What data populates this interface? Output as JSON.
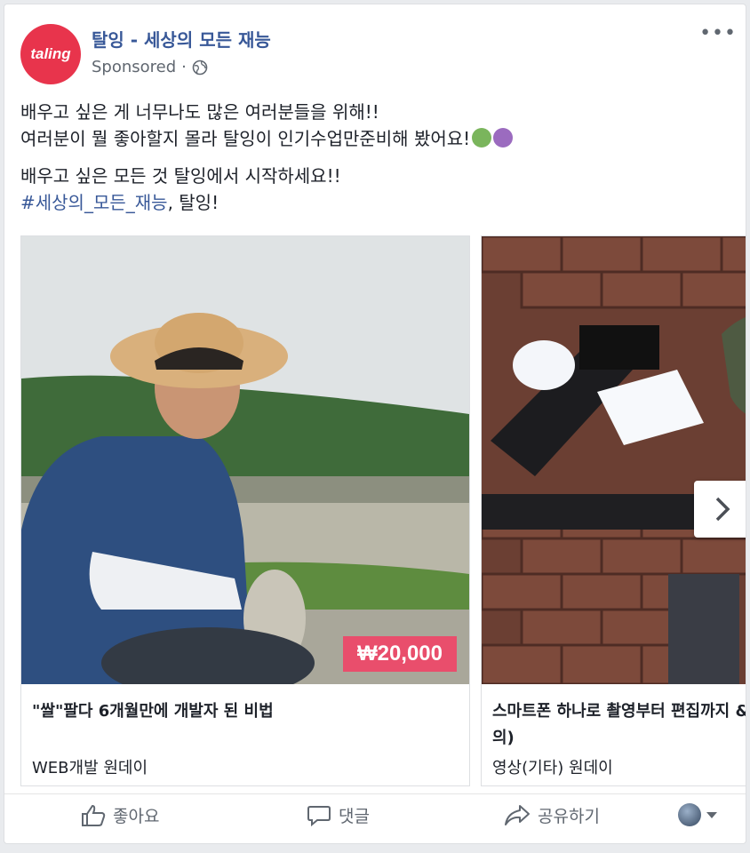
{
  "post": {
    "page_name": "탈잉 - 세상의 모든 재능",
    "avatar_text": "taling",
    "sponsored": "Sponsored",
    "dot": "·",
    "more": "•••",
    "line1": "배우고 싶은 게 너무나도 많은 여러분들을 위해!!",
    "line2": "여러분이 뭘 좋아할지 몰라 탈잉이 인기수업만준비해 봤어요!",
    "line3": "배우고 싶은 모든 것 탈잉에서 시작하세요!!",
    "hashtag": "#세상의_모든_재능",
    "line4_rest": ", 탈잉!",
    "colors": {
      "brand": "#e8344c",
      "link": "#385898",
      "price_bg": "#e94e6c"
    }
  },
  "carousel": {
    "items": [
      {
        "price": "₩20,000",
        "title": "\"쌀\"팔다 6개월만에 개발자 된 비법",
        "subtitle": "WEB개발 원데이",
        "image_icon": "farmer-photo"
      },
      {
        "title": "스마트폰 하나로 촬영부터 편집까지 &",
        "title_wrap": "의)",
        "subtitle": "영상(기타) 원데이",
        "image_icon": "camera-rig-photo"
      }
    ]
  },
  "actions": {
    "like": "좋아요",
    "comment": "댓글",
    "share": "공유하기"
  }
}
